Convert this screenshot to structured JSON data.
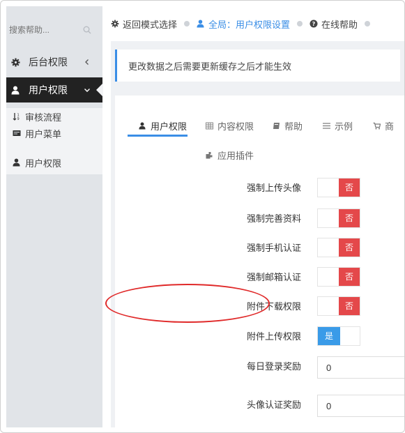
{
  "sidebar": {
    "search": {
      "placeholder": "搜索帮助..."
    },
    "items": [
      {
        "label": "后台权限",
        "icon": "gear-icon"
      },
      {
        "label": "用户权限",
        "icon": "user-icon",
        "active": true
      }
    ],
    "sub_items": [
      {
        "label": "审核流程",
        "icon": "sort-icon"
      },
      {
        "label": "用户菜单",
        "icon": "card-icon"
      },
      {
        "label": "用户权限",
        "icon": "user-icon"
      }
    ]
  },
  "topbar": {
    "back": "返回模式选择",
    "global": "全局：用户权限设置",
    "help": "在线帮助"
  },
  "notice": {
    "text": "更改数据之后需要更新缓存之后才能生效"
  },
  "tabs": [
    {
      "label": "用户权限",
      "icon": "user-icon",
      "active": true
    },
    {
      "label": "内容权限",
      "icon": "table-icon"
    },
    {
      "label": "帮助",
      "icon": "book-icon"
    },
    {
      "label": "示例",
      "icon": "list-icon"
    },
    {
      "label": "商",
      "icon": "cart-icon"
    },
    {
      "label": "应用插件",
      "icon": "puzzle-icon"
    }
  ],
  "form": {
    "toggles": [
      {
        "label": "强制上传头像",
        "value": "否",
        "on": false
      },
      {
        "label": "强制完善资料",
        "value": "否",
        "on": false
      },
      {
        "label": "强制手机认证",
        "value": "否",
        "on": false
      },
      {
        "label": "强制邮箱认证",
        "value": "否",
        "on": false
      },
      {
        "label": "附件下载权限",
        "value": "否",
        "on": false
      },
      {
        "label": "附件上传权限",
        "value": "是",
        "on": true
      }
    ],
    "inputs": [
      {
        "label": "每日登录奖励",
        "value": "0"
      },
      {
        "label": "头像认证奖励",
        "value": "0"
      }
    ]
  },
  "colors": {
    "accent": "#3a8ee6",
    "toggle_no": "#e4484a",
    "toggle_yes": "#3a9be8",
    "highlight": "#e02a2a",
    "sidebar_active": "#222222"
  }
}
